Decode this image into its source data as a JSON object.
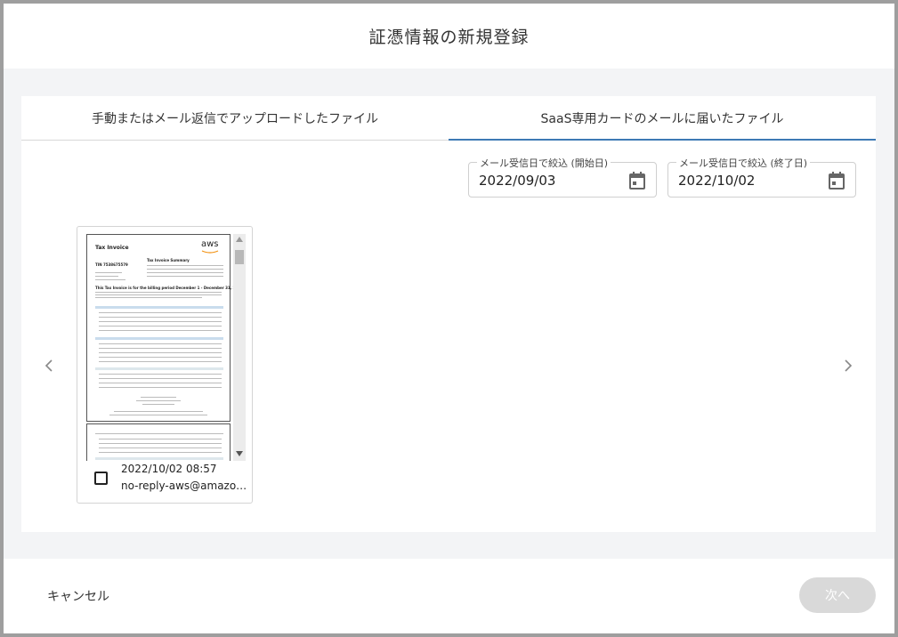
{
  "dialog": {
    "title": "証憑情報の新規登録"
  },
  "tabs": [
    {
      "label": "手動またはメール返信でアップロードしたファイル",
      "active": false
    },
    {
      "label": "SaaS専用カードのメールに届いたファイル",
      "active": true
    }
  ],
  "filters": {
    "start": {
      "label": "メール受信日で絞込 (開始日)",
      "value": "2022/09/03"
    },
    "end": {
      "label": "メール受信日で絞込 (終了日)",
      "value": "2022/10/02"
    }
  },
  "files": [
    {
      "date": "2022/10/02 08:57",
      "sender": "no-reply-aws@amazo…",
      "checked": false,
      "preview": {
        "title": "Tax Invoice",
        "logo": "aws",
        "summary_heading": "Tax Invoice Summary",
        "invoice_no": "TIN 7538675579",
        "period_line": "This Tax Invoice is for the billing period December 1 - December 31, 2021"
      }
    }
  ],
  "footer": {
    "cancel_label": "キャンセル",
    "next_label": "次へ"
  },
  "colors": {
    "accent": "#3d7ab5",
    "disabled_button": "#d9d9d9",
    "body_background": "#f3f4f6"
  },
  "icons": {
    "calendar": "calendar-icon",
    "prev": "chevron-left-icon",
    "next": "chevron-right-icon"
  }
}
